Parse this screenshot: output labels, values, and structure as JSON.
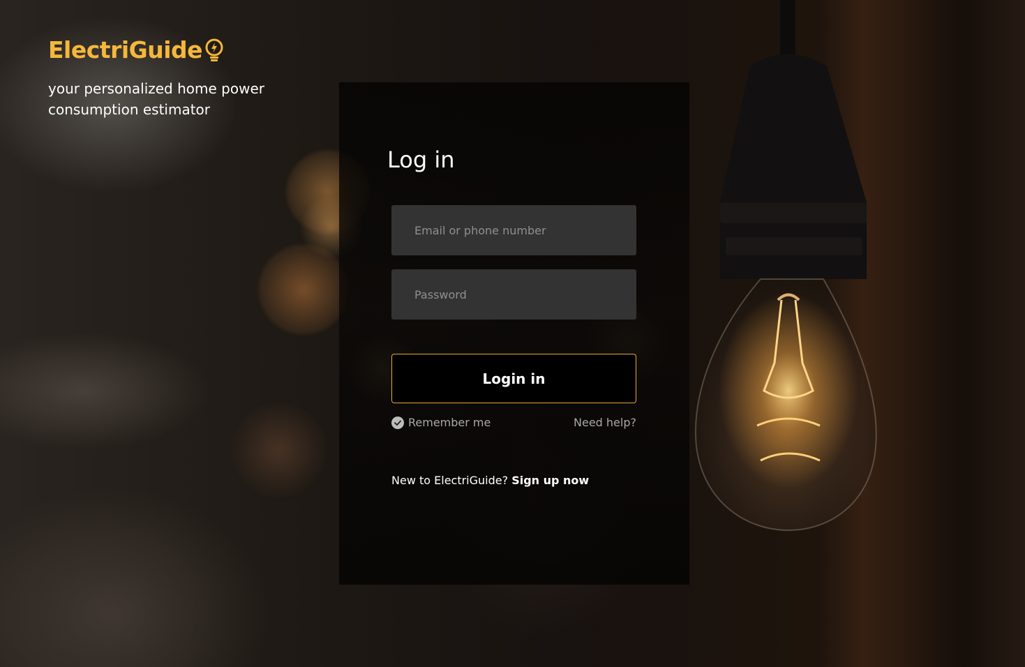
{
  "brand": {
    "name": "ElectriGuide",
    "accent_color": "#f5b83a",
    "tagline": "your personalized home power consumption estimator"
  },
  "login_panel": {
    "title": "Log in",
    "email_placeholder": "Email or phone number",
    "password_placeholder": "Password",
    "submit_label": "Login in",
    "remember_label": "Remember me",
    "remember_checked": true,
    "help_label": "Need help?",
    "signup_prompt": "New to ElectriGuide?",
    "signup_link": "Sign up now"
  },
  "icons": {
    "brand": "lightbulb-bolt-icon",
    "remember": "check-circle-icon"
  }
}
